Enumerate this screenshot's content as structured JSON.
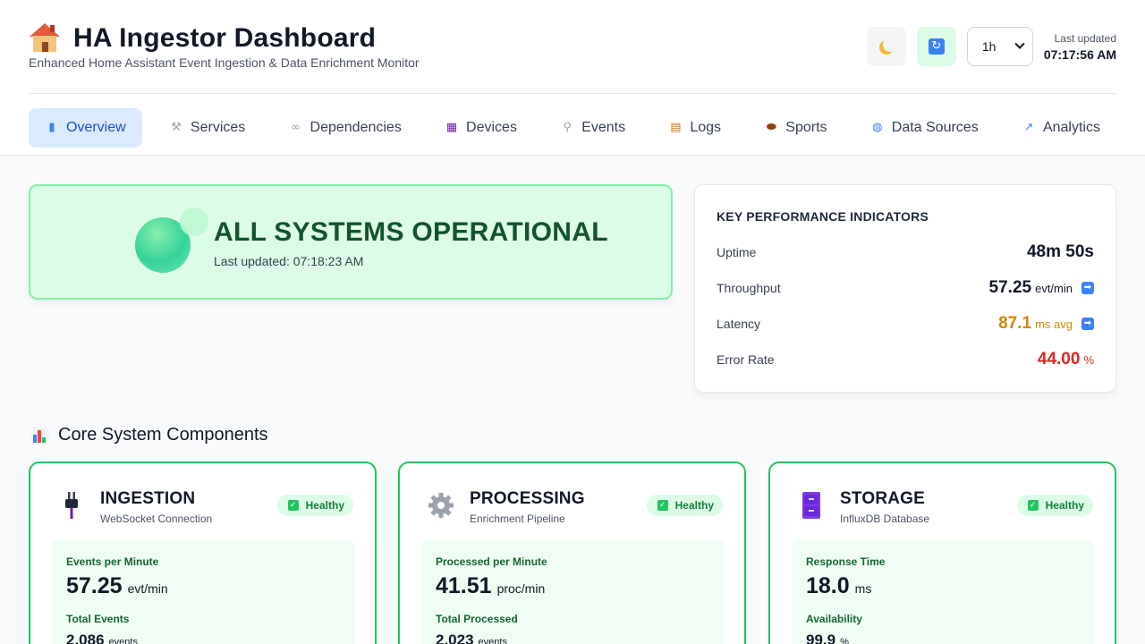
{
  "header": {
    "title": "HA Ingestor Dashboard",
    "subtitle": "Enhanced Home Assistant Event Ingestion & Data Enrichment Monitor",
    "time_range": "1h",
    "last_updated_label": "Last updated",
    "last_updated_value": "07:17:56 AM"
  },
  "tabs": [
    {
      "label": "Overview",
      "icon": "bar-chart-icon",
      "active": true
    },
    {
      "label": "Services",
      "icon": "wrench-icon"
    },
    {
      "label": "Dependencies",
      "icon": "link-icon"
    },
    {
      "label": "Devices",
      "icon": "calculator-icon"
    },
    {
      "label": "Events",
      "icon": "satellite-icon"
    },
    {
      "label": "Logs",
      "icon": "scroll-icon"
    },
    {
      "label": "Sports",
      "icon": "football-icon"
    },
    {
      "label": "Data Sources",
      "icon": "globe-icon"
    },
    {
      "label": "Analytics",
      "icon": "trend-chart-icon"
    }
  ],
  "status": {
    "title": "ALL SYSTEMS OPERATIONAL",
    "last_updated": "Last updated: 07:18:23 AM"
  },
  "kpi": {
    "title": "KEY PERFORMANCE INDICATORS",
    "rows": [
      {
        "label": "Uptime",
        "value": "48m 50s",
        "unit": "",
        "color": "#111827"
      },
      {
        "label": "Throughput",
        "value": "57.25",
        "unit": "evt/min",
        "color": "#111827",
        "trend": "arrow-right-icon"
      },
      {
        "label": "Latency",
        "value": "87.1",
        "unit": "ms avg",
        "color": "#ca8a04",
        "trend": "arrow-right-icon"
      },
      {
        "label": "Error Rate",
        "value": "44.00",
        "unit": "%",
        "color": "#dc2626"
      }
    ]
  },
  "section": {
    "title": "Core System Components"
  },
  "components": [
    {
      "name": "INGESTION",
      "desc": "WebSocket Connection",
      "status": "Healthy",
      "icon": "plug-icon",
      "m1_label": "Events per Minute",
      "m1_value": "57.25",
      "m1_unit": "evt/min",
      "m2_label": "Total Events",
      "m2_value": "2,086",
      "m2_unit": "events"
    },
    {
      "name": "PROCESSING",
      "desc": "Enrichment Pipeline",
      "status": "Healthy",
      "icon": "gear-icon",
      "m1_label": "Processed per Minute",
      "m1_value": "41.51",
      "m1_unit": "proc/min",
      "m2_label": "Total Processed",
      "m2_value": "2,023",
      "m2_unit": "events"
    },
    {
      "name": "STORAGE",
      "desc": "InfluxDB Database",
      "status": "Healthy",
      "icon": "file-cabinet-icon",
      "m1_label": "Response Time",
      "m1_value": "18.0",
      "m1_unit": "ms",
      "m2_label": "Availability",
      "m2_value": "99.9",
      "m2_unit": "%"
    }
  ],
  "colors": {
    "accent": "#1d4ed8",
    "healthy": "#22c55e",
    "status_bg": "#dcfce7"
  }
}
